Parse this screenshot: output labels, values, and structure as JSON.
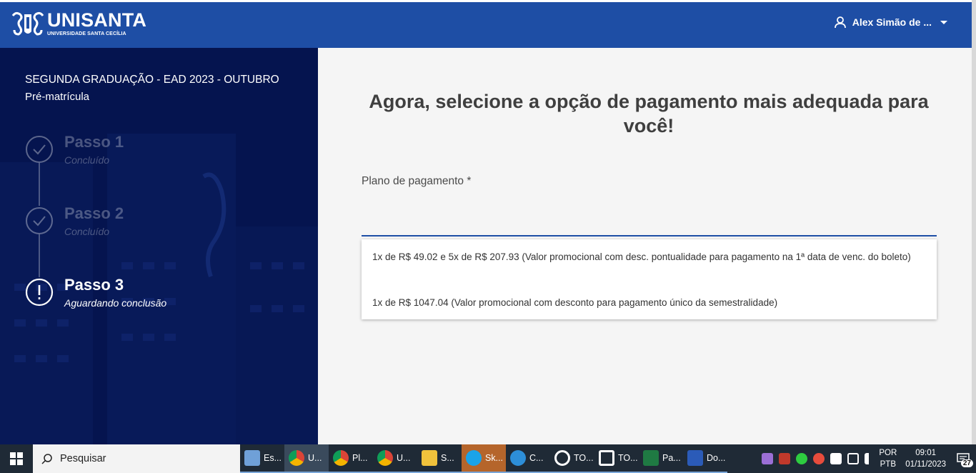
{
  "header": {
    "brand": "UNISANTA",
    "brand_sub": "UNIVERSIDADE SANTA CECÍLIA",
    "user_name": "Alex Simão de ...",
    "color": "#1e4ea5"
  },
  "sidebar": {
    "course_title": "SEGUNDA GRADUAÇÃO - EAD 2023 - OUTUBRO",
    "course_subtitle": "Pré-matrícula",
    "steps": [
      {
        "title": "Passo 1",
        "status": "Concluído",
        "icon": "check-circle-icon"
      },
      {
        "title": "Passo 2",
        "status": "Concluído",
        "icon": "check-circle-icon"
      },
      {
        "title": "Passo 3",
        "status": "Aguardando conclusão",
        "icon": "exclamation-circle-icon"
      }
    ],
    "color": "#05144f"
  },
  "main": {
    "title": "Agora, selecione a opção de pagamento mais adequada para você!",
    "field_label": "Plano de pagamento *",
    "field_value": "",
    "options": [
      "1x de R$ 49.02 e 5x de R$ 207.93 (Valor promocional com desc. pontualidade para pagamento na 1ª data de venc. do boleto)",
      "1x de R$ 1047.04 (Valor promocional com desconto para pagamento único da semestralidade)"
    ]
  },
  "taskbar": {
    "search_placeholder": "Pesquisar",
    "items": [
      {
        "label": "Es...",
        "icon": "laptop-icon",
        "color": "#6fa0d8"
      },
      {
        "label": "U...",
        "icon": "chrome-icon",
        "color": "#e8a33a"
      },
      {
        "label": "Pl...",
        "icon": "chrome-icon",
        "color": "#e8a33a"
      },
      {
        "label": "U...",
        "icon": "chrome-icon",
        "color": "#e8a33a"
      },
      {
        "label": "S...",
        "icon": "snip-icon",
        "color": "#f0c23c"
      },
      {
        "label": "Sk...",
        "icon": "skype-icon",
        "color": "#1aa3e8"
      },
      {
        "label": "C...",
        "icon": "edge-icon",
        "color": "#2d8ed8"
      },
      {
        "label": "TO...",
        "icon": "totvs-icon",
        "color": "#ffffff"
      },
      {
        "label": "TO...",
        "icon": "totvs-icon",
        "color": "#ffffff"
      },
      {
        "label": "Pa...",
        "icon": "excel-icon",
        "color": "#1f7a43"
      },
      {
        "label": "Do...",
        "icon": "word-icon",
        "color": "#2b5bb8"
      }
    ],
    "lang_top": "POR",
    "lang_bottom": "PTB",
    "time": "09:01",
    "date": "01/11/2023",
    "notification_count": "27"
  }
}
